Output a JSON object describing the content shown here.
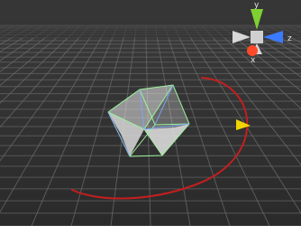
{
  "viewport": {
    "gizmo": {
      "y_label": "y",
      "z_label": "z",
      "x_label": "x",
      "colors": {
        "y": "#7fd133",
        "z": "#3b7bff",
        "x": "#ff4a2a",
        "neutral": "#d8d8d8",
        "center": "#cfcfcf"
      }
    },
    "colors": {
      "background_top": "#3b3b3b",
      "background_bottom": "#2a2a2a",
      "grid": "#6b6b6b",
      "cube_fill": "#d9d9d9",
      "cube_edges": "#9df29d",
      "cube_diagonals": "#7aa7ff",
      "rotation_arc": "#c21f1f",
      "arc_arrow": "#f1d400"
    }
  }
}
